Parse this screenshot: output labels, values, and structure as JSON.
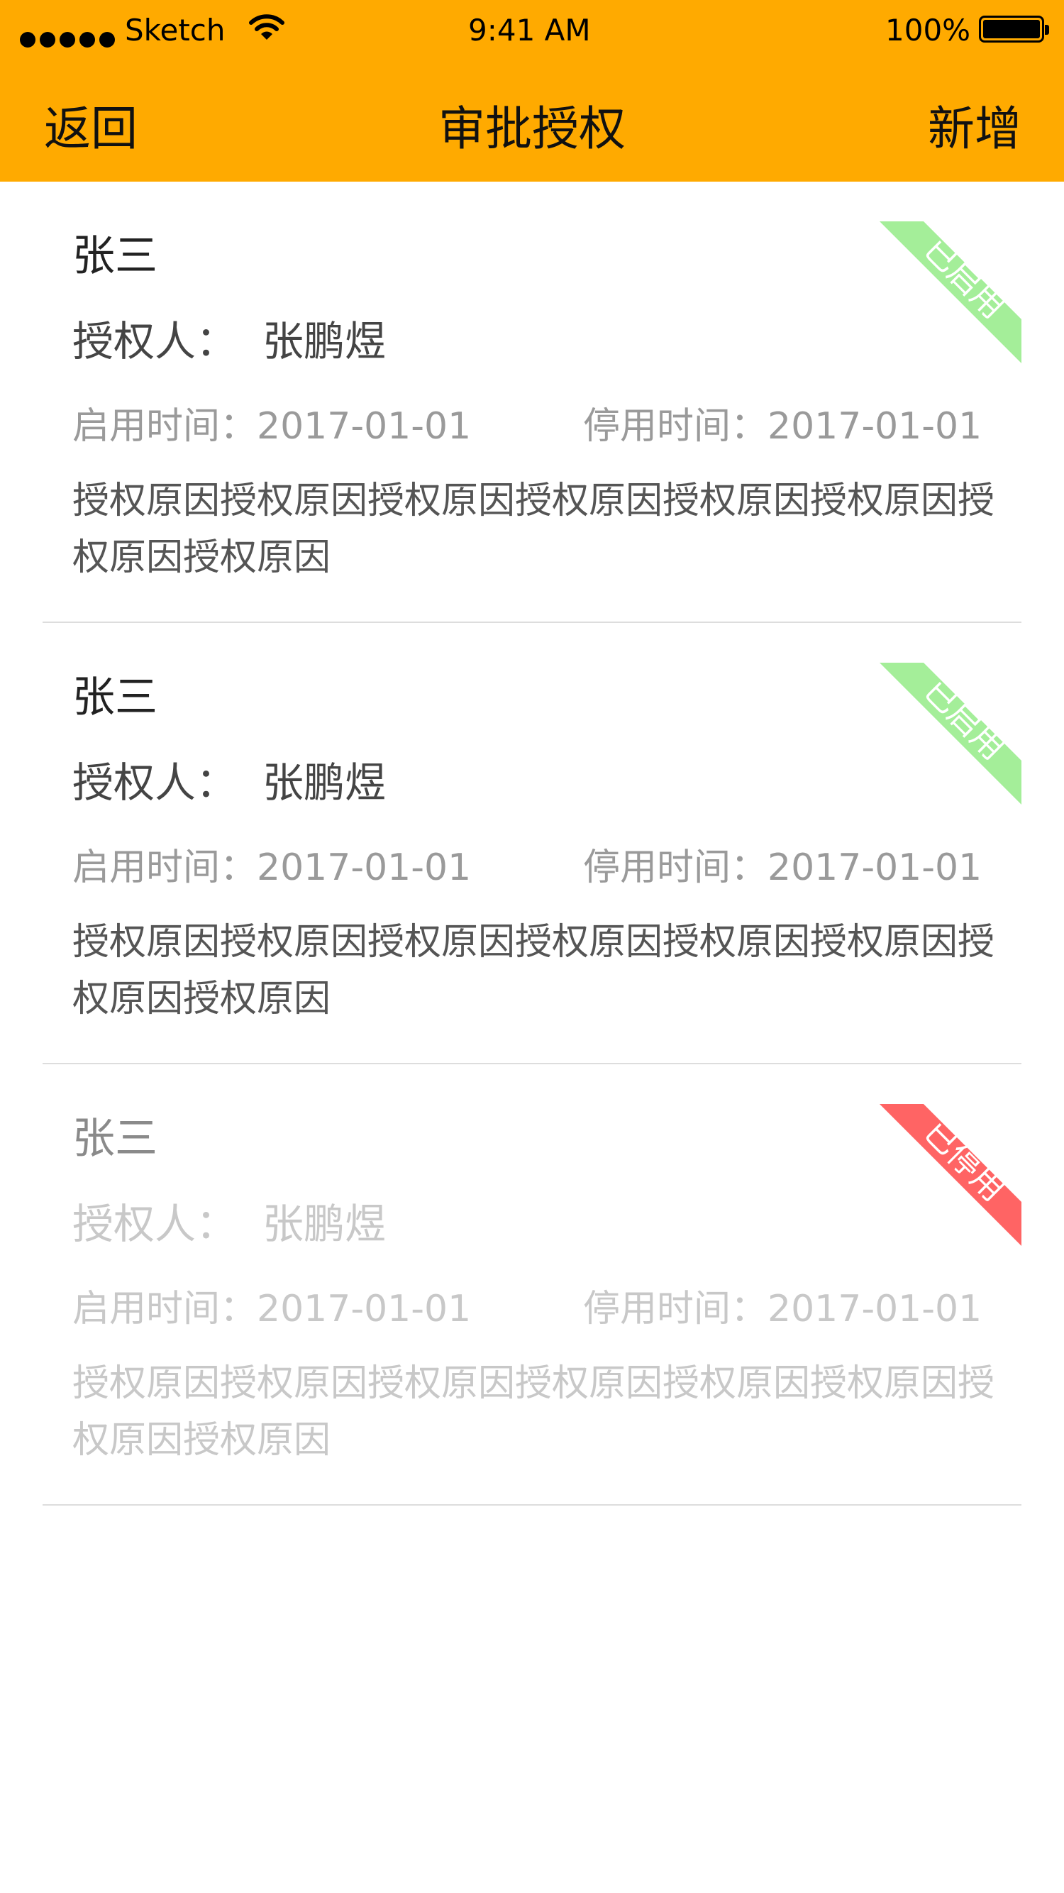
{
  "status_bar": {
    "carrier": "Sketch",
    "time": "9:41 AM",
    "battery": "100%",
    "icons": [
      "signal-dots-icon",
      "wifi-icon",
      "battery-icon"
    ]
  },
  "nav": {
    "back": "返回",
    "title": "审批授权",
    "add": "新增"
  },
  "colors": {
    "header": "#FFAA00",
    "enabled_badge": "#A4EE99",
    "disabled_badge": "#FF6464"
  },
  "records": [
    {
      "name": "张三",
      "authorizer_label": "授权人：",
      "authorizer": "张鹏煜",
      "start": "启用时间：2017-01-01",
      "end": "停用时间：2017-01-01",
      "reason": "授权原因授权原因授权原因授权原因授权原因授权原因授权原因授权原因",
      "status": "已启用"
    },
    {
      "name": "张三",
      "authorizer_label": "授权人：",
      "authorizer": "张鹏煜",
      "start": "启用时间：2017-01-01",
      "end": "停用时间：2017-01-01",
      "reason": "授权原因授权原因授权原因授权原因授权原因授权原因授权原因授权原因",
      "status": "已启用"
    },
    {
      "name": "张三",
      "authorizer_label": "授权人：",
      "authorizer": "张鹏煜",
      "start": "启用时间：2017-01-01",
      "end": "停用时间：2017-01-01",
      "reason": "授权原因授权原因授权原因授权原因授权原因授权原因授权原因授权原因",
      "status": "已停用"
    }
  ]
}
